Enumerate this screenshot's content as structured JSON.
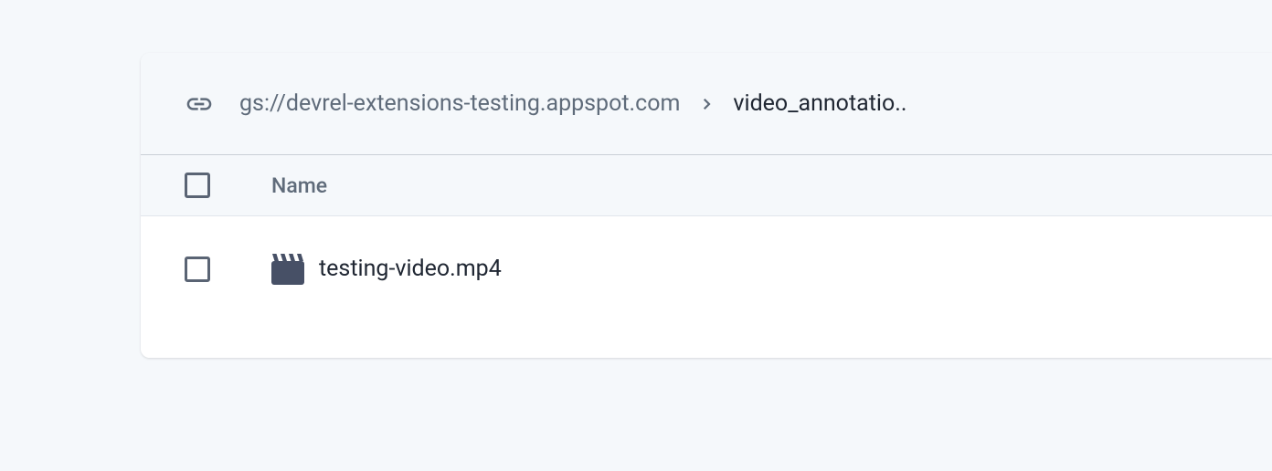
{
  "breadcrumb": {
    "bucket": "gs://devrel-extensions-testing.appspot.com",
    "current": "video_annotatio.."
  },
  "table": {
    "header": {
      "name": "Name"
    },
    "rows": [
      {
        "name": "testing-video.mp4"
      }
    ]
  }
}
